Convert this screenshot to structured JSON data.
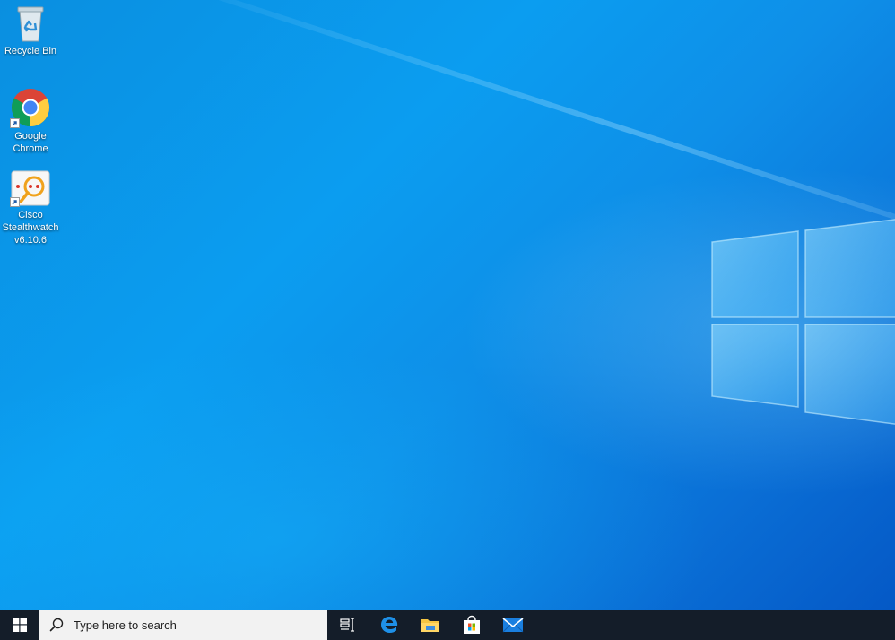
{
  "desktop": {
    "icons": [
      {
        "name": "recycle-bin",
        "label": "Recycle Bin",
        "icon": "recycle-bin-icon"
      },
      {
        "name": "google-chrome",
        "label": "Google Chrome",
        "icon": "chrome-icon"
      },
      {
        "name": "cisco-stealthwatch",
        "label": "Cisco Stealthwatch v6.10.6",
        "icon": "stealthwatch-icon"
      }
    ]
  },
  "taskbar": {
    "start_icon": "windows-logo-icon",
    "search": {
      "placeholder": "Type here to search",
      "icon": "search-icon"
    },
    "apps": [
      {
        "name": "task-view",
        "icon": "task-view-icon"
      },
      {
        "name": "microsoft-edge",
        "icon": "edge-icon"
      },
      {
        "name": "file-explorer",
        "icon": "folder-icon"
      },
      {
        "name": "microsoft-store",
        "icon": "store-icon"
      },
      {
        "name": "mail",
        "icon": "mail-icon"
      }
    ]
  },
  "colors": {
    "desktop_accent": "#0b9df0",
    "taskbar": "#141d29",
    "search_box": "#f2f2f2"
  }
}
